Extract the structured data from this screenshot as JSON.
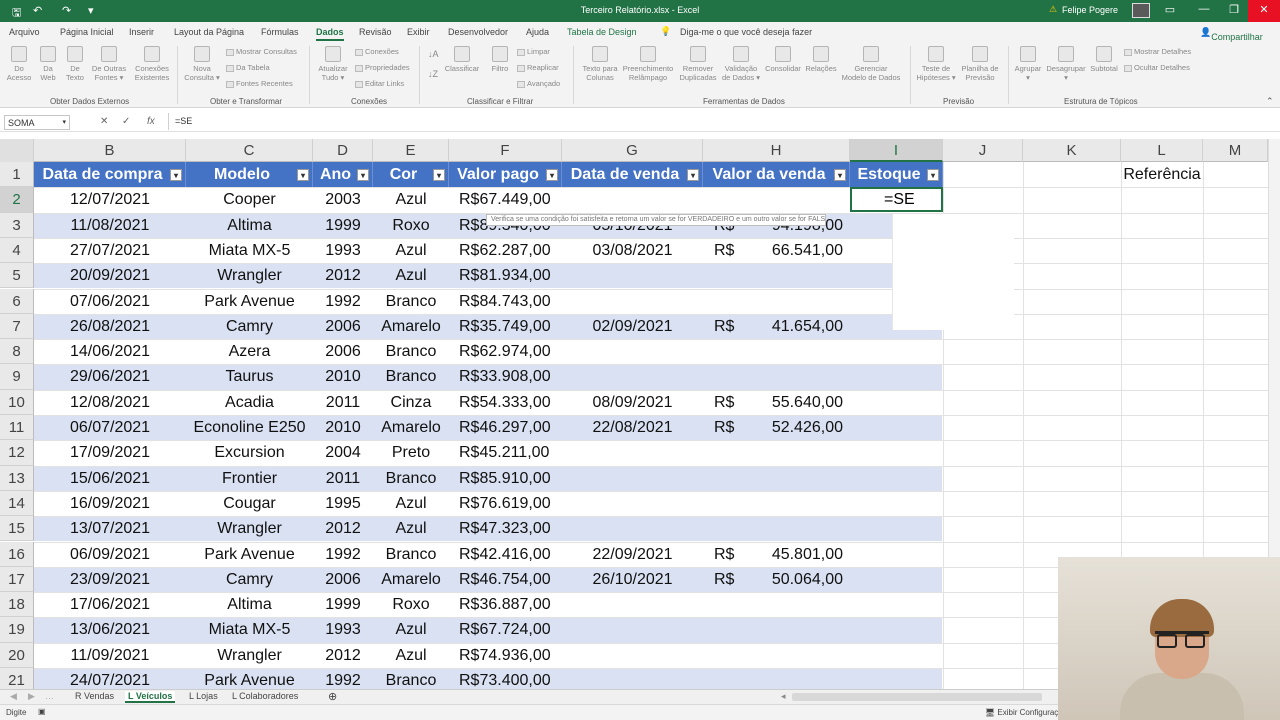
{
  "titlebar": {
    "title": "Terceiro Relatório.xlsx  -  Excel",
    "user": "Felipe Pogere",
    "warn": "⚠",
    "save": "🖫",
    "undo": "↶",
    "redo": "↷",
    "more": "▾",
    "ribbon_opts": "▭",
    "min": "—",
    "max": "❐",
    "close": "✕"
  },
  "menu": [
    "Arquivo",
    "Página Inicial",
    "Inserir",
    "Layout da Página",
    "Fórmulas",
    "Dados",
    "Revisão",
    "Exibir",
    "Desenvolvedor",
    "Ajuda",
    "Tabela de Design"
  ],
  "tell_me": "Diga-me o que você deseja fazer",
  "share": "Compartilhar",
  "tell_icon": "lightbulb-icon",
  "share_icon": "person-icon",
  "ribbon": {
    "get_data": [
      {
        "l1": "Do",
        "l2": "Acesso"
      },
      {
        "l1": "Da",
        "l2": "Web"
      },
      {
        "l1": "De",
        "l2": "Texto"
      },
      {
        "l1": "De Outras",
        "l2": "Fontes ▾"
      },
      {
        "l1": "Conexões",
        "l2": "Existentes"
      }
    ],
    "transform_big": {
      "l1": "Nova",
      "l2": "Consulta ▾"
    },
    "transform_small": [
      "Mostrar Consultas",
      "Da Tabela",
      "Fontes Recentes"
    ],
    "refresh": {
      "l1": "Atualizar",
      "l2": "Tudo ▾"
    },
    "connections": [
      "Conexões",
      "Propriedades",
      "Editar Links"
    ],
    "sort_small": [
      "Classificar"
    ],
    "filter": "Filtro",
    "filter_small": [
      "Limpar",
      "Reaplicar",
      "Avançado"
    ],
    "tools": [
      {
        "l1": "Texto para",
        "l2": "Colunas"
      },
      {
        "l1": "Preenchimento",
        "l2": "Relâmpago"
      },
      {
        "l1": "Remover",
        "l2": "Duplicadas"
      },
      {
        "l1": "Validação",
        "l2": "de Dados ▾"
      },
      {
        "l1": "Consolidar",
        "l2": ""
      },
      {
        "l1": "Relações",
        "l2": ""
      },
      {
        "l1": "Gerenciar",
        "l2": "Modelo de Dados"
      }
    ],
    "forecast": [
      {
        "l1": "Teste de",
        "l2": "Hipóteses ▾"
      },
      {
        "l1": "Planilha de",
        "l2": "Previsão"
      }
    ],
    "outline": [
      {
        "l1": "Agrupar",
        "l2": "▾"
      },
      {
        "l1": "Desagrupar",
        "l2": "▾"
      },
      {
        "l1": "Subtotal",
        "l2": ""
      }
    ],
    "outline_small": [
      "Mostrar Detalhes",
      "Ocultar Detalhes"
    ],
    "groups": [
      "Obter Dados Externos",
      "Obter e Transformar",
      "Conexões",
      "Classificar e Filtrar",
      "Ferramentas de Dados",
      "Previsão",
      "Estrutura de Tópicos"
    ]
  },
  "formula_bar": {
    "name_box": "SOMA",
    "cancel": "✕",
    "enter": "✓",
    "fx": "fx",
    "formula": "=SE"
  },
  "columns": [
    "B",
    "C",
    "D",
    "E",
    "F",
    "G",
    "H",
    "I",
    "J",
    "K",
    "L",
    "M"
  ],
  "row_numbers": [
    "1",
    "2",
    "3",
    "4",
    "5",
    "6",
    "7",
    "8",
    "9",
    "10",
    "11",
    "12",
    "13",
    "14",
    "15",
    "16",
    "17",
    "18",
    "19",
    "20",
    "21"
  ],
  "headers": [
    "Data de compra",
    "Modelo",
    "Ano",
    "Cor",
    "Valor pago",
    "Data de venda",
    "Valor da venda",
    "Estoque"
  ],
  "filter_icon": "▾",
  "k1": "Referência",
  "rows": [
    [
      "12/07/2021",
      "Cooper",
      "2003",
      "Azul",
      "R$67.449,00",
      "",
      "",
      ""
    ],
    [
      "11/08/2021",
      "Altima",
      "1999",
      "Roxo",
      "R$89.340,00",
      "05/10/2021",
      "R$",
      "94.198,00"
    ],
    [
      "27/07/2021",
      "Miata MX-5",
      "1993",
      "Azul",
      "R$62.287,00",
      "03/08/2021",
      "R$",
      "66.541,00"
    ],
    [
      "20/09/2021",
      "Wrangler",
      "2012",
      "Azul",
      "R$81.934,00",
      "",
      "",
      ""
    ],
    [
      "07/06/2021",
      "Park Avenue",
      "1992",
      "Branco",
      "R$84.743,00",
      "",
      "",
      ""
    ],
    [
      "26/08/2021",
      "Camry",
      "2006",
      "Amarelo",
      "R$35.749,00",
      "02/09/2021",
      "R$",
      "41.654,00"
    ],
    [
      "14/06/2021",
      "Azera",
      "2006",
      "Branco",
      "R$62.974,00",
      "",
      "",
      ""
    ],
    [
      "29/06/2021",
      "Taurus",
      "2010",
      "Branco",
      "R$33.908,00",
      "",
      "",
      ""
    ],
    [
      "12/08/2021",
      "Acadia",
      "2011",
      "Cinza",
      "R$54.333,00",
      "08/09/2021",
      "R$",
      "55.640,00"
    ],
    [
      "06/07/2021",
      "Econoline E250",
      "2010",
      "Amarelo",
      "R$46.297,00",
      "22/08/2021",
      "R$",
      "52.426,00"
    ],
    [
      "17/09/2021",
      "Excursion",
      "2004",
      "Preto",
      "R$45.211,00",
      "",
      "",
      ""
    ],
    [
      "15/06/2021",
      "Frontier",
      "2011",
      "Branco",
      "R$85.910,00",
      "",
      "",
      ""
    ],
    [
      "16/09/2021",
      "Cougar",
      "1995",
      "Azul",
      "R$76.619,00",
      "",
      "",
      ""
    ],
    [
      "13/07/2021",
      "Wrangler",
      "2012",
      "Azul",
      "R$47.323,00",
      "",
      "",
      ""
    ],
    [
      "06/09/2021",
      "Park Avenue",
      "1992",
      "Branco",
      "R$42.416,00",
      "22/09/2021",
      "R$",
      "45.801,00"
    ],
    [
      "23/09/2021",
      "Camry",
      "2006",
      "Amarelo",
      "R$46.754,00",
      "26/10/2021",
      "R$",
      "50.064,00"
    ],
    [
      "17/06/2021",
      "Altima",
      "1999",
      "Roxo",
      "R$36.887,00",
      "",
      "",
      ""
    ],
    [
      "13/06/2021",
      "Miata MX-5",
      "1993",
      "Azul",
      "R$67.724,00",
      "",
      "",
      ""
    ],
    [
      "11/09/2021",
      "Wrangler",
      "2012",
      "Azul",
      "R$74.936,00",
      "",
      "",
      ""
    ],
    [
      "24/07/2021",
      "Park Avenue",
      "1992",
      "Branco",
      "R$73.400,00",
      "",
      "",
      ""
    ]
  ],
  "active_cell": "=SE",
  "tooltip": "Verifica se uma condição foi satisfeita e retorna um valor se for VERDADEIRO e um outro valor se for FALSO",
  "sheets": [
    "R Vendas",
    "L Veículos",
    "L Lojas",
    "L Colaboradores"
  ],
  "add_sheet": "⊕",
  "status": {
    "mode": "Digite",
    "display_settings": "Exibir Configurações"
  },
  "colors": {
    "excel_green": "#217346",
    "table_header": "#4472c4",
    "band": "#d9e1f2"
  }
}
